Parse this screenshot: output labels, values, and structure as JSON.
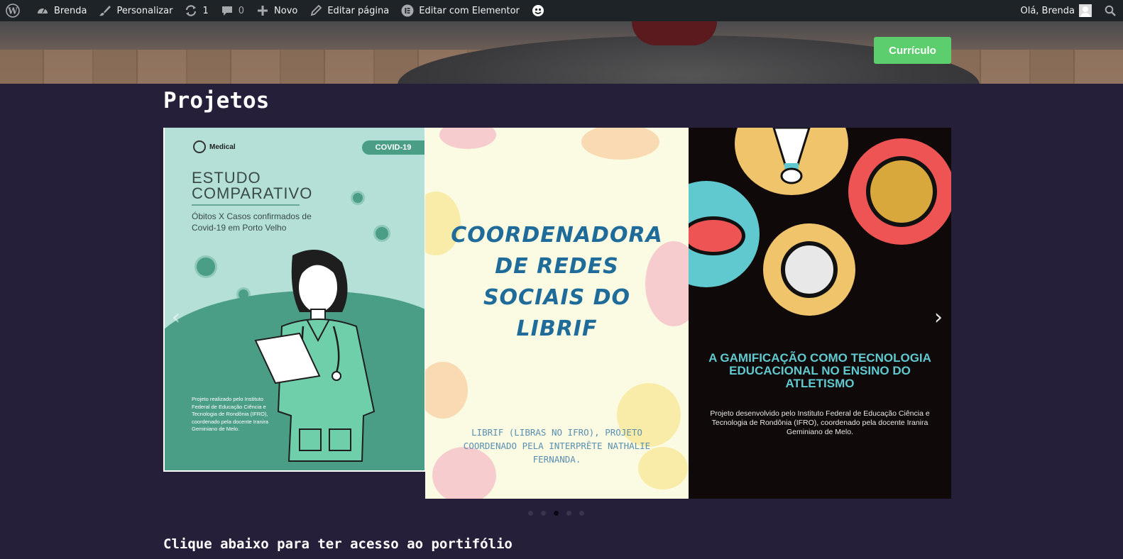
{
  "admin_bar": {
    "site_name": "Brenda",
    "customize": "Personalizar",
    "updates_count": "1",
    "comments_count": "0",
    "new": "Novo",
    "edit_page": "Editar página",
    "edit_elementor": "Editar com Elementor",
    "greeting": "Olá, Brenda",
    "icons": [
      "wordpress-icon",
      "dashboard-icon",
      "brush-icon",
      "refresh-icon",
      "comment-icon",
      "plus-icon",
      "pencil-icon",
      "elementor-icon",
      "smiley-icon",
      "search-icon"
    ]
  },
  "hero": {
    "button_label": "Currículo",
    "button_color": "#5cce6e"
  },
  "section": {
    "title": "Projetos"
  },
  "carousel": {
    "slides": [
      {
        "brand": "Medical",
        "badge": "COVID-19",
        "title_line1": "ESTUDO",
        "title_line2": "COMPARATIVO",
        "subtitle": "Óbitos X Casos confirmados de Covid-19 em Porto Velho",
        "note": "Projeto realizado pelo Instituto Federal de Educação Ciência e Tecnologia de Rondônia (IFRO), coordenado pela docente Iranira Geminiano de Melo."
      },
      {
        "title": "COORDENADORA DE REDES SOCIAIS DO LIBRIF",
        "description": "LIBRIF (LIBRAS NO IFRO), PROJETO COORDENADO PELA INTERPRÊTE NATHALIE FERNANDA."
      },
      {
        "title": "A GAMIFICAÇÃO COMO TECNOLOGIA EDUCACIONAL NO ENSINO DO ATLETISMO",
        "description": "Projeto desenvolvido pelo Instituto Federal de Educação Ciência e Tecnologia de Rondônia (IFRO), coordenado pela docente Iranira Geminiano de Melo."
      }
    ],
    "prev_icon": "chevron-left-icon",
    "next_icon": "chevron-right-icon",
    "prev_glyph": "‹",
    "next_glyph": "›",
    "dot_count": 5,
    "active_dot": 3
  },
  "cta": {
    "text": "Clique abaixo para ter acesso ao portifólio"
  },
  "colors": {
    "page_bg": "#251f3a",
    "admin_bg": "#1d2327",
    "librif_blue": "#1f6b9a",
    "gamif_cyan": "#5fc9cf",
    "covid_green": "#4b9e86"
  }
}
